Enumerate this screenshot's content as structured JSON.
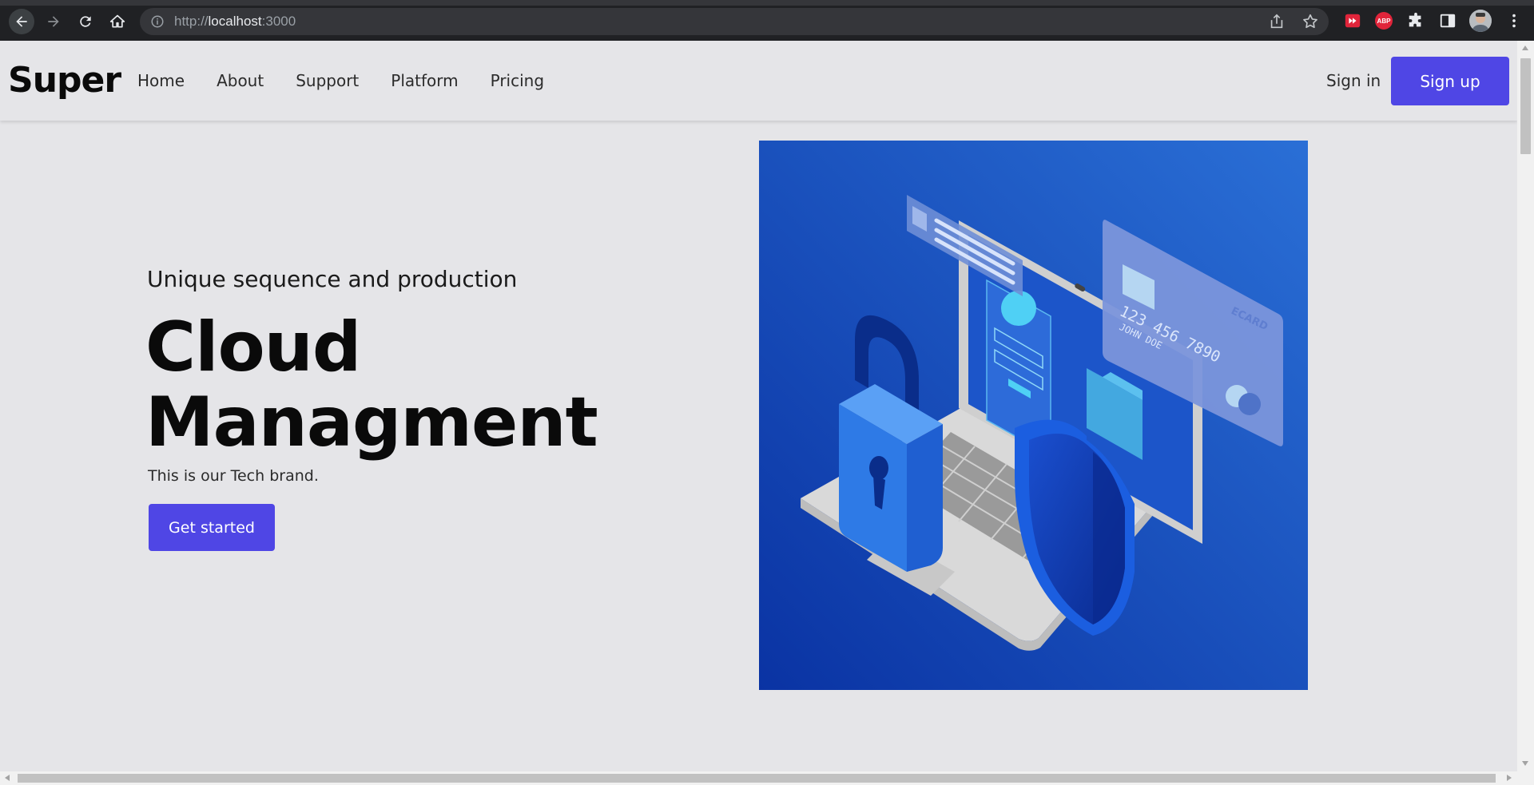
{
  "browser": {
    "url_scheme": "http://",
    "url_host": "localhost",
    "url_port": ":3000"
  },
  "header": {
    "brand": "Super",
    "nav": [
      "Home",
      "About",
      "Support",
      "Platform",
      "Pricing"
    ],
    "signin": "Sign in",
    "signup": "Sign up"
  },
  "hero": {
    "subtitle": "Unique sequence and production",
    "title_line1": "Cloud",
    "title_line2": "Managment",
    "description": "This is our Tech brand.",
    "cta": "Get started"
  },
  "illustration": {
    "card_brand": "ECARD",
    "card_number": "123 456 7890",
    "card_holder": "JOHN DOE",
    "colors": {
      "bg_top": "#2a6fd6",
      "bg_bottom": "#0a33a3",
      "accent": "#4f46e5"
    }
  }
}
